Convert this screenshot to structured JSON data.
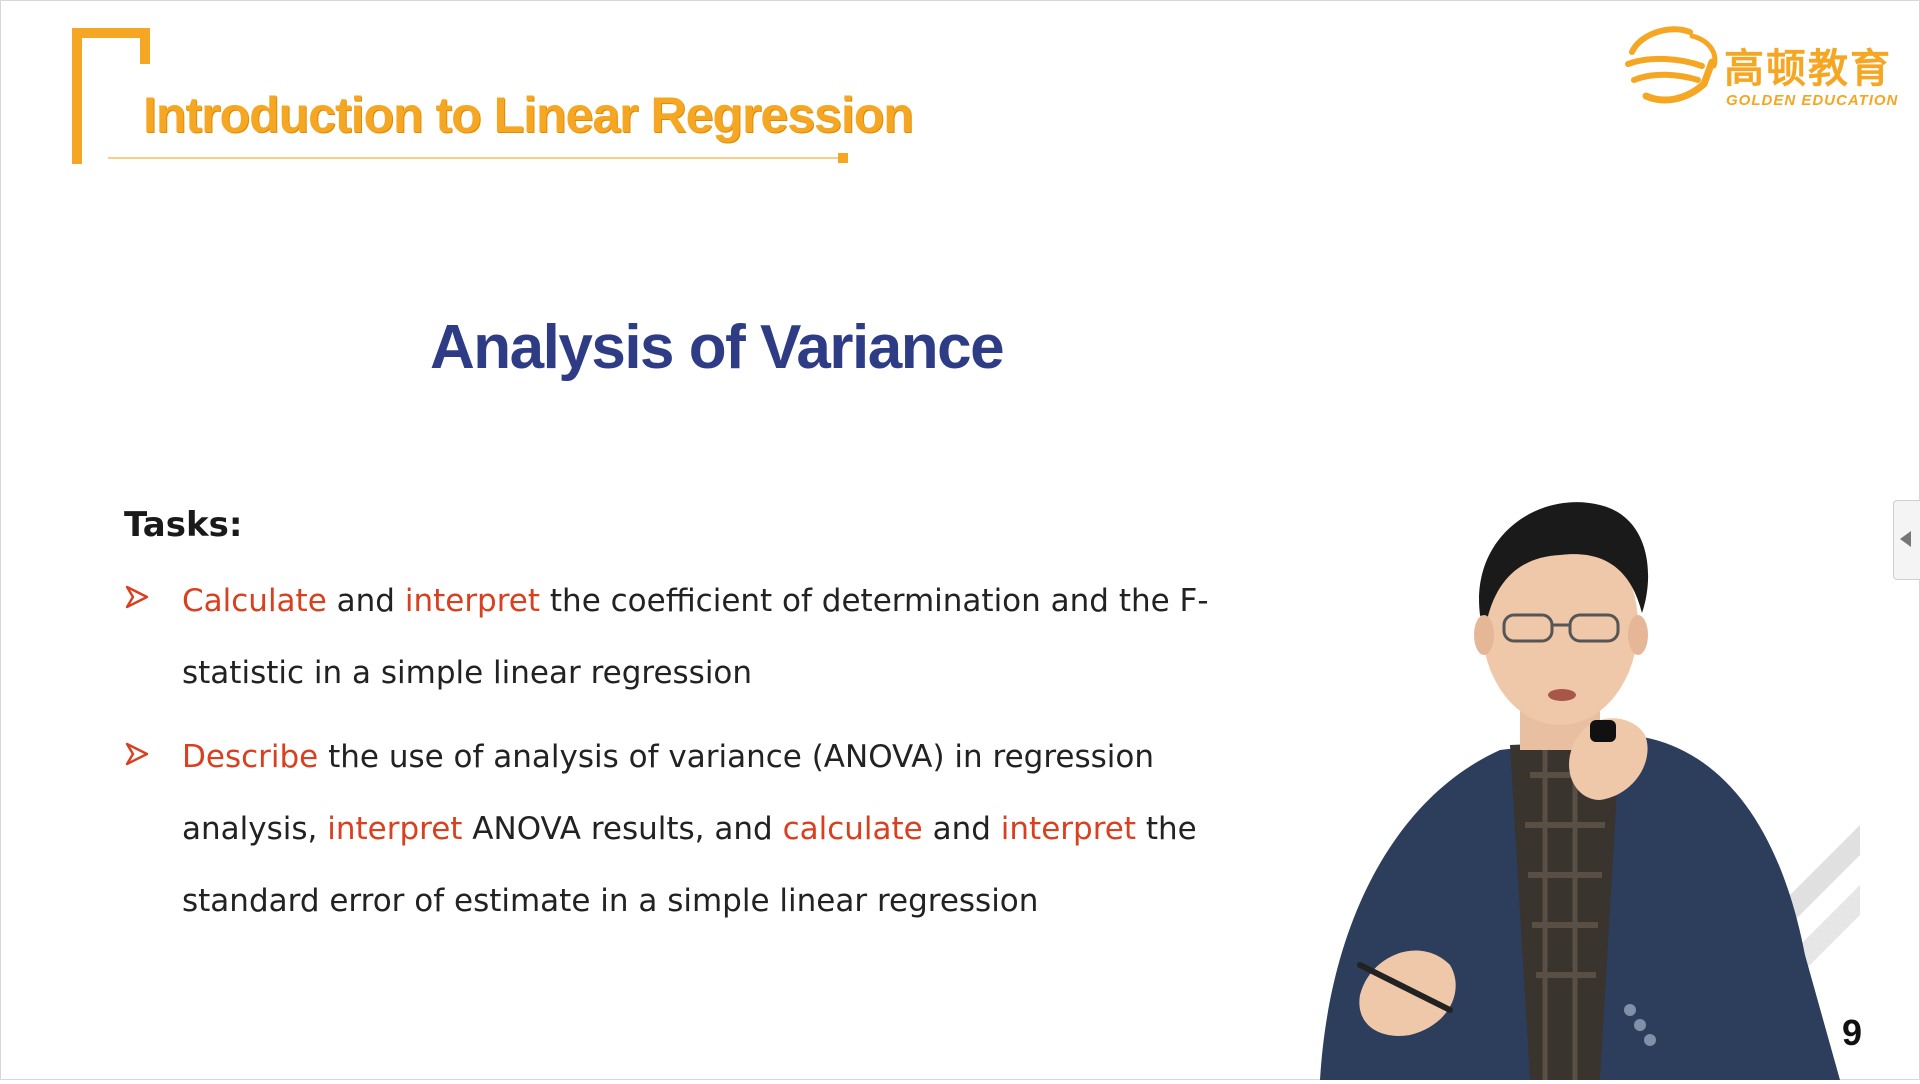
{
  "header": {
    "title": "Introduction to Linear Regression"
  },
  "logo": {
    "chinese": "高顿教育",
    "english": "GOLDEN EDUCATION"
  },
  "slide": {
    "title": "Analysis of Variance",
    "tasks_label": "Tasks:",
    "task1": {
      "w1": "Calculate",
      "t1": " and ",
      "w2": "interpret",
      "t2": " the coefficient of determination and the F-statistic in a simple linear regression"
    },
    "task2": {
      "w1": "Describe",
      "t1": " the use of analysis of variance (ANOVA) in regression analysis, ",
      "w2": "interpret",
      "t2": " ANOVA results, and ",
      "w3": "calculate",
      "t3": " and ",
      "w4": "interpret",
      "t4": " the standard error of estimate in a simple linear regression"
    },
    "page_number": "9"
  },
  "colors": {
    "accent_orange": "#f5a623",
    "title_navy": "#2e3c86",
    "highlight_red": "#d9401f",
    "body_text": "#222222"
  },
  "icons": {
    "bullet": "arrow-bullet-icon",
    "side_tab": "collapse-arrow-icon"
  }
}
